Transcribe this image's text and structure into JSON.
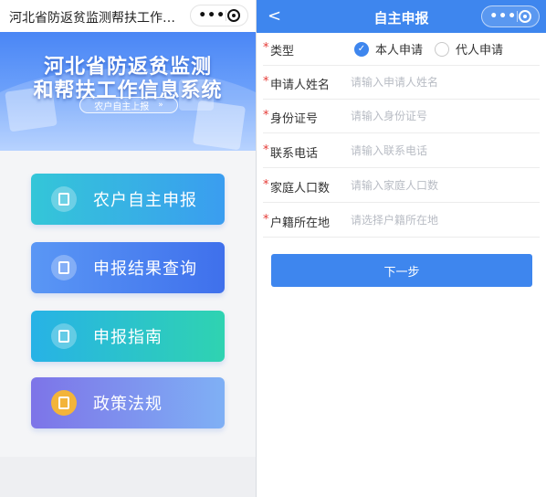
{
  "left": {
    "header": {
      "title": "河北省防返贫监测帮扶工作…"
    },
    "banner": {
      "title_line1": "河北省防返贫监测",
      "title_line2": "和帮扶工作信息系统",
      "pill_label": "农户自主上报",
      "pill_arrow": "»"
    },
    "menu": [
      {
        "label": "农户自主申报",
        "icon": "document-icon"
      },
      {
        "label": "申报结果查询",
        "icon": "search-document-icon"
      },
      {
        "label": "申报指南",
        "icon": "guide-book-icon"
      },
      {
        "label": "政策法规",
        "icon": "policy-edit-icon"
      }
    ]
  },
  "right": {
    "header": {
      "back": "<",
      "title": "自主申报"
    },
    "form": {
      "type_label": "类型",
      "type_options": [
        "本人申请",
        "代人申请"
      ],
      "type_selected": "本人申请",
      "fields": [
        {
          "label": "申请人姓名",
          "placeholder": "请输入申请人姓名",
          "value": ""
        },
        {
          "label": "身份证号",
          "placeholder": "请输入身份证号",
          "value": ""
        },
        {
          "label": "联系电话",
          "placeholder": "请输入联系电话",
          "value": ""
        },
        {
          "label": "家庭人口数",
          "placeholder": "请输入家庭人口数",
          "value": ""
        },
        {
          "label": "户籍所在地",
          "placeholder": "请选择户籍所在地",
          "value": ""
        }
      ],
      "required_mark": "*",
      "submit_label": "下一步"
    }
  },
  "capsule": {
    "dots": "•••"
  },
  "colors": {
    "primary": "#3e86ee",
    "required": "#e53935"
  }
}
